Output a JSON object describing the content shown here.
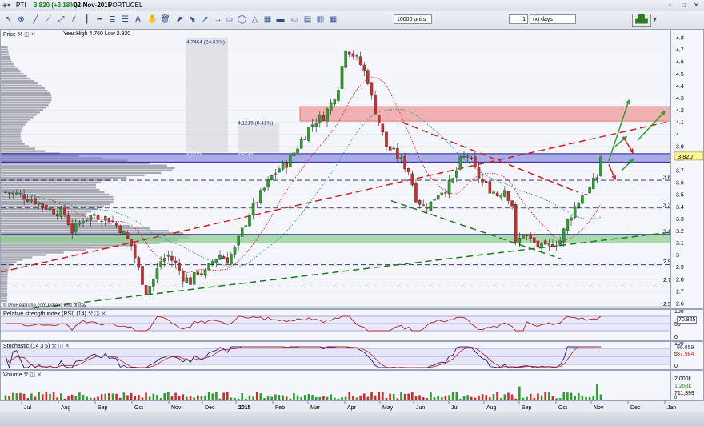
{
  "header": {
    "symbol": "PTI",
    "price": "3.820 (+3.18%)",
    "date": "02-Nov-2015",
    "name": "PORTUCEL"
  },
  "toolbar": {
    "units": "10000 units",
    "period_value": "1",
    "period_unit": "(x) days"
  },
  "price_panel": {
    "title": "Price",
    "year_range": "Year:High 4.760 Low 2.930",
    "box1_label": "4.7464 (24.67%)",
    "box2_label": "4.1215 (8.41%)",
    "band_labels": [
      "3.8063",
      "3.8019"
    ],
    "current_price": "3.820",
    "watermark": "© ProRealTime.com  Data is end of day"
  },
  "rsi_panel": {
    "title": "Relative strength index (RSI) (14)",
    "value": "70.825",
    "levels": [
      "100",
      "50",
      "0"
    ]
  },
  "stoch_panel": {
    "title": "Stochastic (14 3 5)",
    "value1": "96.859",
    "value2": "87.984",
    "levels": [
      "100",
      "50",
      "0"
    ]
  },
  "volume_panel": {
    "title": "Volume",
    "scale": "2,000k",
    "value1": "1.258k",
    "value2": "711,399",
    "baseline": "0"
  },
  "chart_data": {
    "type": "candlestick",
    "y_axis_ticks": [
      4.8,
      4.7,
      4.6,
      4.5,
      4.4,
      4.3,
      4.2,
      4.1,
      4,
      3.9,
      3.8,
      3.7,
      3.6,
      3.5,
      3.4,
      3.3,
      3.2,
      3.1,
      3,
      2.9,
      2.8,
      2.7,
      2.6
    ],
    "horizontal_level_labels": [
      "3.62",
      "3.39",
      "3.17",
      "2.92",
      "2.77",
      "2.57"
    ],
    "x_axis_labels": [
      "Jul",
      "Aug",
      "Sep",
      "Oct",
      "Nov",
      "Dec",
      "2015",
      "Feb",
      "Mar",
      "Apr",
      "May",
      "Jun",
      "Jul",
      "Aug",
      "Sep",
      "Oct",
      "Nov",
      "Dec",
      "Jan"
    ],
    "ylim": [
      2.55,
      4.84
    ],
    "close_path": [
      [
        0,
        3.52
      ],
      [
        4,
        3.5
      ],
      [
        8,
        3.45
      ],
      [
        12,
        3.38
      ],
      [
        16,
        3.34
      ],
      [
        18,
        3.2
      ],
      [
        21,
        3.3
      ],
      [
        24,
        3.33
      ],
      [
        28,
        3.3
      ],
      [
        31,
        3.22
      ],
      [
        34,
        3.08
      ],
      [
        36,
        2.88
      ],
      [
        38,
        2.7
      ],
      [
        40,
        2.8
      ],
      [
        42,
        2.95
      ],
      [
        44,
        3.0
      ],
      [
        46,
        2.92
      ],
      [
        48,
        2.82
      ],
      [
        50,
        2.78
      ],
      [
        52,
        2.86
      ],
      [
        54,
        2.85
      ],
      [
        56,
        2.95
      ],
      [
        58,
        3.0
      ],
      [
        60,
        2.96
      ],
      [
        62,
        3.05
      ],
      [
        64,
        3.2
      ],
      [
        66,
        3.35
      ],
      [
        68,
        3.45
      ],
      [
        70,
        3.55
      ],
      [
        72,
        3.65
      ],
      [
        74,
        3.72
      ],
      [
        76,
        3.76
      ],
      [
        78,
        3.85
      ],
      [
        80,
        3.95
      ],
      [
        82,
        4.05
      ],
      [
        84,
        4.12
      ],
      [
        86,
        4.15
      ],
      [
        88,
        4.25
      ],
      [
        90,
        4.4
      ],
      [
        92,
        4.72
      ],
      [
        94,
        4.66
      ],
      [
        96,
        4.58
      ],
      [
        98,
        4.45
      ],
      [
        99,
        4.3
      ],
      [
        101,
        4.1
      ],
      [
        103,
        3.9
      ],
      [
        105,
        3.85
      ],
      [
        107,
        3.78
      ],
      [
        109,
        3.7
      ],
      [
        111,
        3.48
      ],
      [
        113,
        3.4
      ],
      [
        115,
        3.43
      ],
      [
        117,
        3.52
      ],
      [
        119,
        3.55
      ],
      [
        121,
        3.62
      ],
      [
        123,
        3.78
      ],
      [
        125,
        3.83
      ],
      [
        127,
        3.7
      ],
      [
        129,
        3.6
      ],
      [
        131,
        3.55
      ],
      [
        133,
        3.5
      ],
      [
        135,
        3.55
      ],
      [
        137,
        3.42
      ],
      [
        138,
        3.08
      ],
      [
        140,
        3.18
      ],
      [
        142,
        3.12
      ],
      [
        144,
        3.08
      ],
      [
        146,
        3.05
      ],
      [
        148,
        3.1
      ],
      [
        150,
        3.12
      ],
      [
        152,
        3.28
      ],
      [
        154,
        3.4
      ],
      [
        156,
        3.5
      ],
      [
        158,
        3.55
      ],
      [
        160,
        3.65
      ],
      [
        161,
        3.82
      ]
    ],
    "series": [
      {
        "name": "Stochastic %K",
        "level_now": 96.859
      },
      {
        "name": "Stochastic %D",
        "level_now": 87.984
      },
      {
        "name": "RSI (14)",
        "level_now": 70.825
      }
    ]
  }
}
